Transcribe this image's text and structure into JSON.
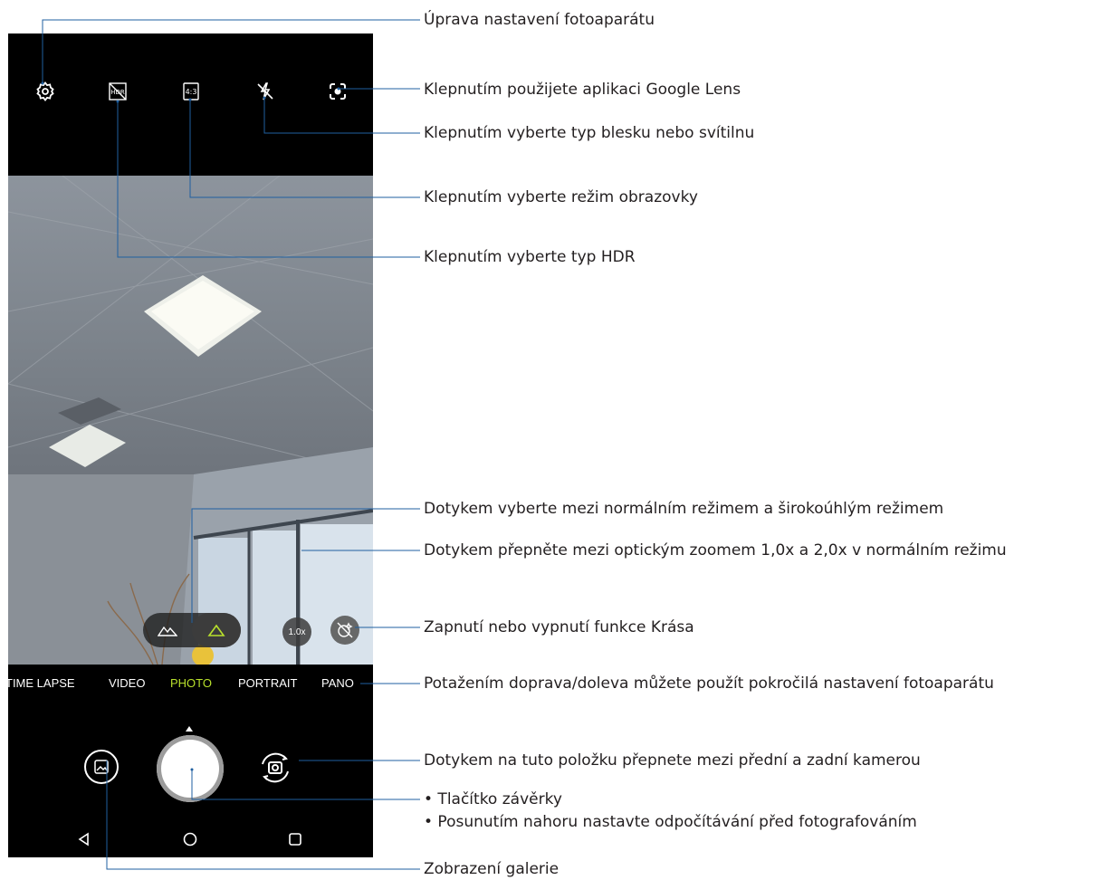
{
  "camera": {
    "top_icons": [
      {
        "name": "settings-icon"
      },
      {
        "name": "hdr-off-icon"
      },
      {
        "name": "aspect-ratio-icon",
        "text": "4:3"
      },
      {
        "name": "flash-off-icon"
      },
      {
        "name": "google-lens-icon"
      }
    ],
    "zoom_label": "1.0x",
    "modes": [
      "TIME LAPSE",
      "VIDEO",
      "PHOTO",
      "PORTRAIT",
      "PANO"
    ],
    "active_mode": "PHOTO",
    "accent_color": "#b9e12c"
  },
  "callouts": {
    "settings": "Úprava nastavení fotoaparátu",
    "lens": "Klepnutím použijete aplikaci Google Lens",
    "flash": "Klepnutím vyberte typ blesku nebo svítilnu",
    "screen_mode": "Klepnutím vyberte režim obrazovky",
    "hdr": "Klepnutím vyberte typ HDR",
    "wide": "Dotykem vyberte mezi normálním režimem a širokoúhlým režimem",
    "zoom": "Dotykem přepněte mezi optickým zoomem 1,0x a 2,0x v normálním režimu",
    "beauty": "Zapnutí nebo vypnutí funkce Krása",
    "swipe": "Potažením doprava/doleva můžete použít pokročilá nastavení fotoaparátu",
    "switch": "Dotykem na tuto položku přepnete mezi přední a zadní kamerou",
    "shutter_1": "• Tlačítko závěrky",
    "shutter_2": "• Posunutím nahoru nastavte odpočítávání před fotografováním",
    "gallery": "Zobrazení galerie"
  }
}
